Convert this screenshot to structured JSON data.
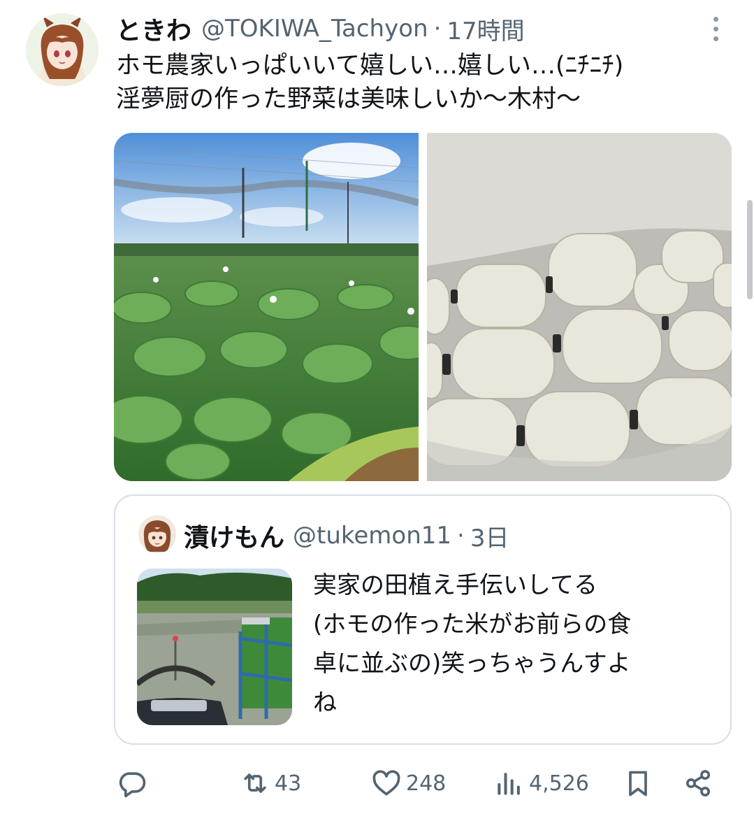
{
  "tweet": {
    "author": {
      "display_name": "ときわ",
      "handle": "@TOKIWA_Tachyon",
      "separator": "·",
      "time": "17時間"
    },
    "text_lines": [
      "ホモ農家いっぱいいて嬉しい…嬉しい…(ﾆﾁﾆﾁ)",
      "淫夢厨の作った野菜は美味しいか〜木村〜"
    ],
    "media": [
      {
        "icon": "photo-lotus-field"
      },
      {
        "icon": "photo-lotus-roots-box"
      }
    ]
  },
  "quote": {
    "author": {
      "display_name": "漬けもん",
      "handle": "@tukemon11",
      "separator": "·",
      "time": "3日"
    },
    "text_lines": [
      "実家の田植え手伝いしてる",
      "(ホモの作った米がお前らの食",
      "卓に並ぶの)笑っちゃうんすよ",
      "ね"
    ]
  },
  "actions": {
    "reply": {
      "icon": "reply-icon",
      "count": ""
    },
    "retweet": {
      "icon": "retweet-icon",
      "count": "43"
    },
    "like": {
      "icon": "like-icon",
      "count": "248"
    },
    "views": {
      "icon": "views-icon",
      "count": "4,526"
    },
    "bookmark": {
      "icon": "bookmark-icon"
    },
    "share": {
      "icon": "share-icon"
    }
  },
  "colors": {
    "text_primary": "#0f1419",
    "text_secondary": "#536471",
    "border": "#d9dee3"
  }
}
